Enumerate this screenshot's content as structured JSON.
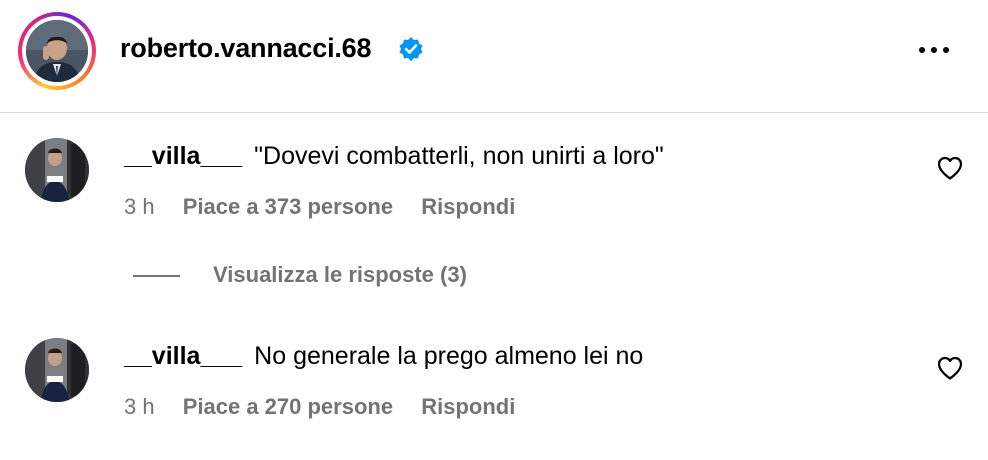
{
  "post_header": {
    "username": "roberto.vannacci.68",
    "verified_icon": "verified-badge-icon",
    "more_icon": "more-options-icon"
  },
  "comments": [
    {
      "username": "__villa___",
      "text": "\"Dovevi combatterli, non unirti a loro\"",
      "time": "3 h",
      "likes": "Piace a 373 persone",
      "reply_label": "Rispondi"
    },
    {
      "username": "__villa___",
      "text": "No generale la prego almeno lei no",
      "time": "3 h",
      "likes": "Piace a 270 persone",
      "reply_label": "Rispondi"
    }
  ],
  "view_replies": {
    "label": "Visualizza le risposte (3)"
  },
  "colors": {
    "verified": "#0095f6",
    "secondary_text": "#737373",
    "divider": "#dbdbdb"
  }
}
